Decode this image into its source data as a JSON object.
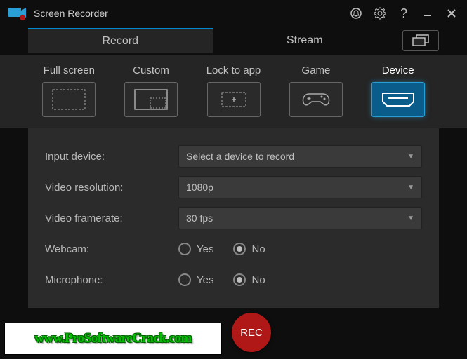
{
  "app": {
    "title": "Screen Recorder"
  },
  "tabs": {
    "record": "Record",
    "stream": "Stream"
  },
  "modes": {
    "fullscreen": "Full screen",
    "custom": "Custom",
    "locktoapp": "Lock to app",
    "game": "Game",
    "device": "Device"
  },
  "settings": {
    "input_device_label": "Input device:",
    "input_device_value": "Select a device to record",
    "resolution_label": "Video resolution:",
    "resolution_value": "1080p",
    "framerate_label": "Video framerate:",
    "framerate_value": "30 fps",
    "webcam_label": "Webcam:",
    "webcam_yes": "Yes",
    "webcam_no": "No",
    "webcam_selected": "No",
    "microphone_label": "Microphone:",
    "microphone_yes": "Yes",
    "microphone_no": "No",
    "microphone_selected": "No"
  },
  "rec_button": "REC",
  "watermark": "www.ProSoftwareCrack.com"
}
